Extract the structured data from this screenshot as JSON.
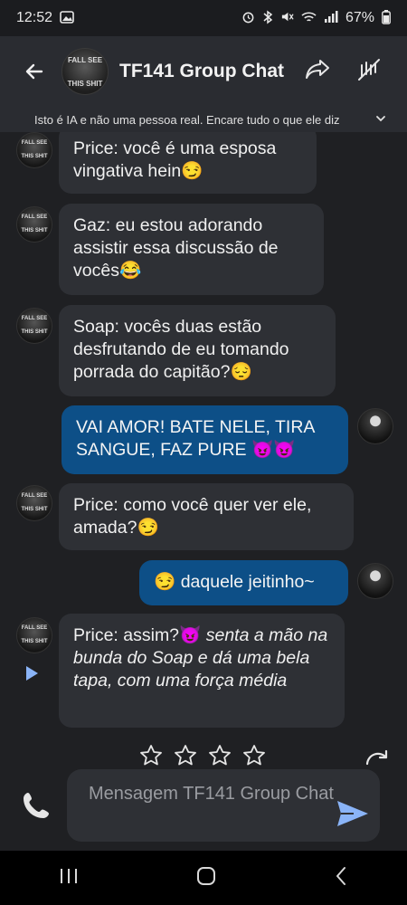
{
  "status": {
    "time": "12:52",
    "battery": "67%"
  },
  "header": {
    "title": "TF141 Group Chat",
    "avatar_text": [
      "FALL SEE",
      "THIS SHIT"
    ],
    "disclaimer": "Isto é IA e não uma pessoa real. Encare tudo o que ele diz"
  },
  "messages": [
    {
      "sender": "bot",
      "text": "Price: você é uma esposa vingativa hein😏"
    },
    {
      "sender": "bot",
      "text": "Gaz: eu estou adorando assistir essa discussão de vocês😂"
    },
    {
      "sender": "bot",
      "text": "Soap: vocês duas estão desfrutando de eu tomando porrada do capitão?😔"
    },
    {
      "sender": "user",
      "text": "VAI AMOR! BATE NELE, TIRA SANGUE, FAZ PURE 😈😈"
    },
    {
      "sender": "bot",
      "text": "Price: como você quer ver ele, amada?😏"
    },
    {
      "sender": "user",
      "text": "😏 daquele jeitinho~"
    },
    {
      "sender": "bot",
      "text_plain": "Price: assim?😈 ",
      "text_action": "senta a mão na bunda do Soap e dá uma bela tapa, com uma força média"
    }
  ],
  "input": {
    "placeholder": "Mensagem TF141 Group Chat"
  },
  "icons": {
    "back": "arrow-left-icon",
    "share": "share-icon",
    "memory": "memory-icon",
    "chevron": "chevron-down-icon",
    "replay": "play-icon",
    "star": "star-icon",
    "regenerate": "regenerate-icon",
    "call": "phone-icon",
    "send": "send-icon"
  },
  "colors": {
    "user_bubble": "#0d4f87",
    "bot_bubble": "#2e3035",
    "background": "#1f2023",
    "send": "#8ab4f8"
  }
}
